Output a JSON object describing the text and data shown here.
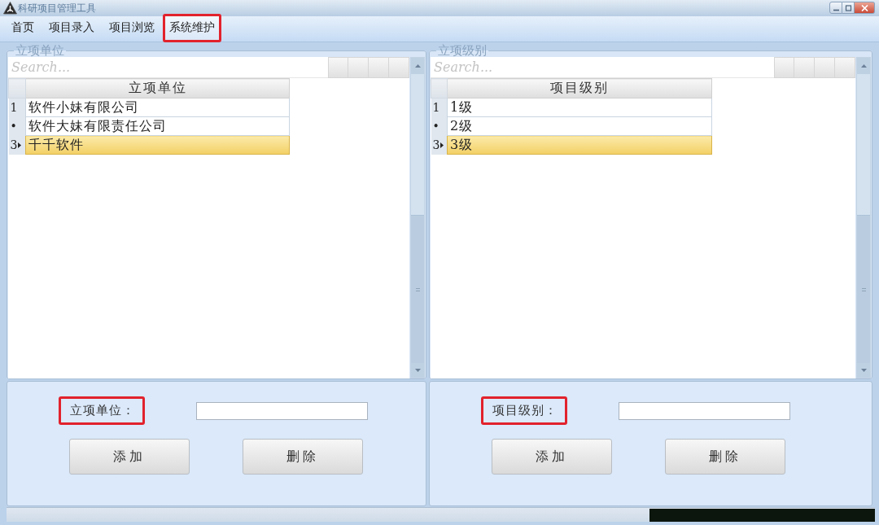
{
  "window": {
    "title": "科研项目管理工具"
  },
  "menu": [
    {
      "label": "首页",
      "selected": false,
      "highlighted": false
    },
    {
      "label": "项目录入",
      "selected": false,
      "highlighted": false
    },
    {
      "label": "项目浏览",
      "selected": false,
      "highlighted": false
    },
    {
      "label": "系统维护",
      "selected": true,
      "highlighted": true
    }
  ],
  "panels": [
    {
      "group_title": "立项单位",
      "search": {
        "placeholder": "Search..."
      },
      "table": {
        "columns": [
          "立项单位"
        ],
        "rows": [
          {
            "row_header": "1",
            "cells": [
              "软件小妹有限公司"
            ],
            "selected": false
          },
          {
            "row_header": "•",
            "cells": [
              "软件大妹有限责任公司"
            ],
            "selected": false
          },
          {
            "row_header": "3",
            "cells": [
              "千千软件"
            ],
            "selected": true
          }
        ]
      },
      "form": {
        "label": "立项单位：",
        "highlighted": true,
        "buttons": [
          "添加",
          "删除"
        ]
      }
    },
    {
      "group_title": "立项级别",
      "search": {
        "placeholder": "Search..."
      },
      "table": {
        "columns": [
          "项目级别"
        ],
        "rows": [
          {
            "row_header": "1",
            "cells": [
              "1级"
            ],
            "selected": false
          },
          {
            "row_header": "•",
            "cells": [
              "2级"
            ],
            "selected": false
          },
          {
            "row_header": "3",
            "cells": [
              "3级"
            ],
            "selected": true
          }
        ]
      },
      "form": {
        "label": "项目级别：",
        "highlighted": true,
        "buttons": [
          "添加",
          "删除"
        ]
      }
    }
  ]
}
